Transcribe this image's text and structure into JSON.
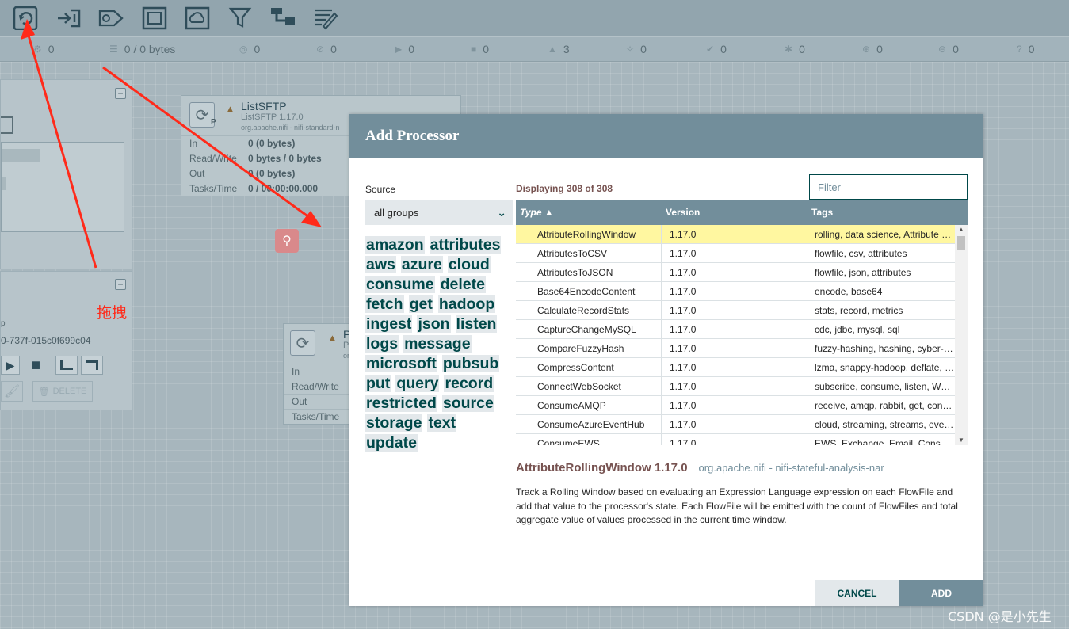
{
  "toolbar": {
    "items": [
      {
        "icon": "processor-icon",
        "label": "Processor"
      },
      {
        "icon": "input-port-icon",
        "label": "Input Port"
      },
      {
        "icon": "output-port-icon",
        "label": "Output Port"
      },
      {
        "icon": "process-group-icon",
        "label": "Process Group"
      },
      {
        "icon": "remote-process-group-icon",
        "label": "Remote Process Group"
      },
      {
        "icon": "funnel-icon",
        "label": "Funnel"
      },
      {
        "icon": "template-icon",
        "label": "Template"
      },
      {
        "icon": "label-icon",
        "label": "Label"
      }
    ]
  },
  "status": {
    "threads": "0",
    "queued": "0 / 0 bytes",
    "transmitting": "0",
    "not_transmitting": "0",
    "running": "0",
    "stopped": "0",
    "invalid": "3",
    "disabled": "0",
    "up_to_date": "0",
    "locally_modified": "0",
    "stale": "0",
    "errors": "0",
    "sync_failure": "0"
  },
  "canvas": {
    "listsftp": {
      "name": "ListSFTP",
      "version": "ListSFTP 1.17.0",
      "bundle": "org.apache.nifi - nifi-standard-n",
      "rows": [
        {
          "k": "In",
          "v": "0 (0 bytes)"
        },
        {
          "k": "Read/Write",
          "v": "0 bytes / 0 bytes"
        },
        {
          "k": "Out",
          "v": "0 (0 bytes)"
        },
        {
          "k": "Tasks/Time",
          "v": "0 / 00:00:00.000"
        }
      ]
    },
    "second_node": {
      "name": "P",
      "line2": "P",
      "line3": "or",
      "rows": [
        {
          "k": "In",
          "v": ""
        },
        {
          "k": "Read/Write",
          "v": ""
        },
        {
          "k": "Out",
          "v": ""
        },
        {
          "k": "Tasks/Time",
          "v": ""
        }
      ]
    },
    "group_id": "0-737f-015c0f699c04",
    "group_p": "p",
    "delete_label": "DELETE",
    "annotation_text": "拖拽"
  },
  "dialog": {
    "title": "Add Processor",
    "source_label": "Source",
    "source_value": "all groups",
    "tags": [
      "amazon",
      "attributes",
      "aws",
      "azure",
      "cloud",
      "consume",
      "delete",
      "fetch",
      "get",
      "hadoop",
      "ingest",
      "json",
      "listen",
      "logs",
      "message",
      "microsoft",
      "pubsub",
      "put",
      "query",
      "record",
      "restricted",
      "source",
      "storage",
      "text",
      "update"
    ],
    "displaying": "Displaying 308 of 308",
    "filter_placeholder": "Filter",
    "columns": {
      "type": "Type ▲",
      "version": "Version",
      "tags": "Tags"
    },
    "rows": [
      {
        "type": "AttributeRollingWindow",
        "version": "1.17.0",
        "tags": "rolling, data science, Attribute Expression Language, state"
      },
      {
        "type": "AttributesToCSV",
        "version": "1.17.0",
        "tags": "flowfile, csv, attributes"
      },
      {
        "type": "AttributesToJSON",
        "version": "1.17.0",
        "tags": "flowfile, json, attributes"
      },
      {
        "type": "Base64EncodeContent",
        "version": "1.17.0",
        "tags": "encode, base64"
      },
      {
        "type": "CalculateRecordStats",
        "version": "1.17.0",
        "tags": "stats, record, metrics"
      },
      {
        "type": "CaptureChangeMySQL",
        "version": "1.17.0",
        "tags": "cdc, jdbc, mysql, sql"
      },
      {
        "type": "CompareFuzzyHash",
        "version": "1.17.0",
        "tags": "fuzzy-hashing, hashing, cyber-security"
      },
      {
        "type": "CompressContent",
        "version": "1.17.0",
        "tags": "lzma, snappy-hadoop, deflate, snappy"
      },
      {
        "type": "ConnectWebSocket",
        "version": "1.17.0",
        "tags": "subscribe, consume, listen, WebSocket"
      },
      {
        "type": "ConsumeAMQP",
        "version": "1.17.0",
        "tags": "receive, amqp, rabbit, get, consume"
      },
      {
        "type": "ConsumeAzureEventHub",
        "version": "1.17.0",
        "tags": "cloud, streaming, streams, eventhub"
      },
      {
        "type": "ConsumeEWS",
        "version": "1.17.0",
        "tags": "EWS, Exchange, Email, Consume"
      }
    ],
    "selected": {
      "name": "AttributeRollingWindow 1.17.0",
      "bundle": "org.apache.nifi - nifi-stateful-analysis-nar",
      "description": "Track a Rolling Window based on evaluating an Expression Language expression on each FlowFile and add that value to the processor's state. Each FlowFile will be emitted with the count of FlowFiles and total aggregate value of values processed in the current time window."
    },
    "cancel_label": "CANCEL",
    "add_label": "ADD"
  },
  "watermark": "CSDN @是小先生",
  "colors": {
    "header": "#728e9b",
    "selected_row": "#fff7a0",
    "tag_text": "#004849",
    "accent_red": "#ff2a1a"
  }
}
